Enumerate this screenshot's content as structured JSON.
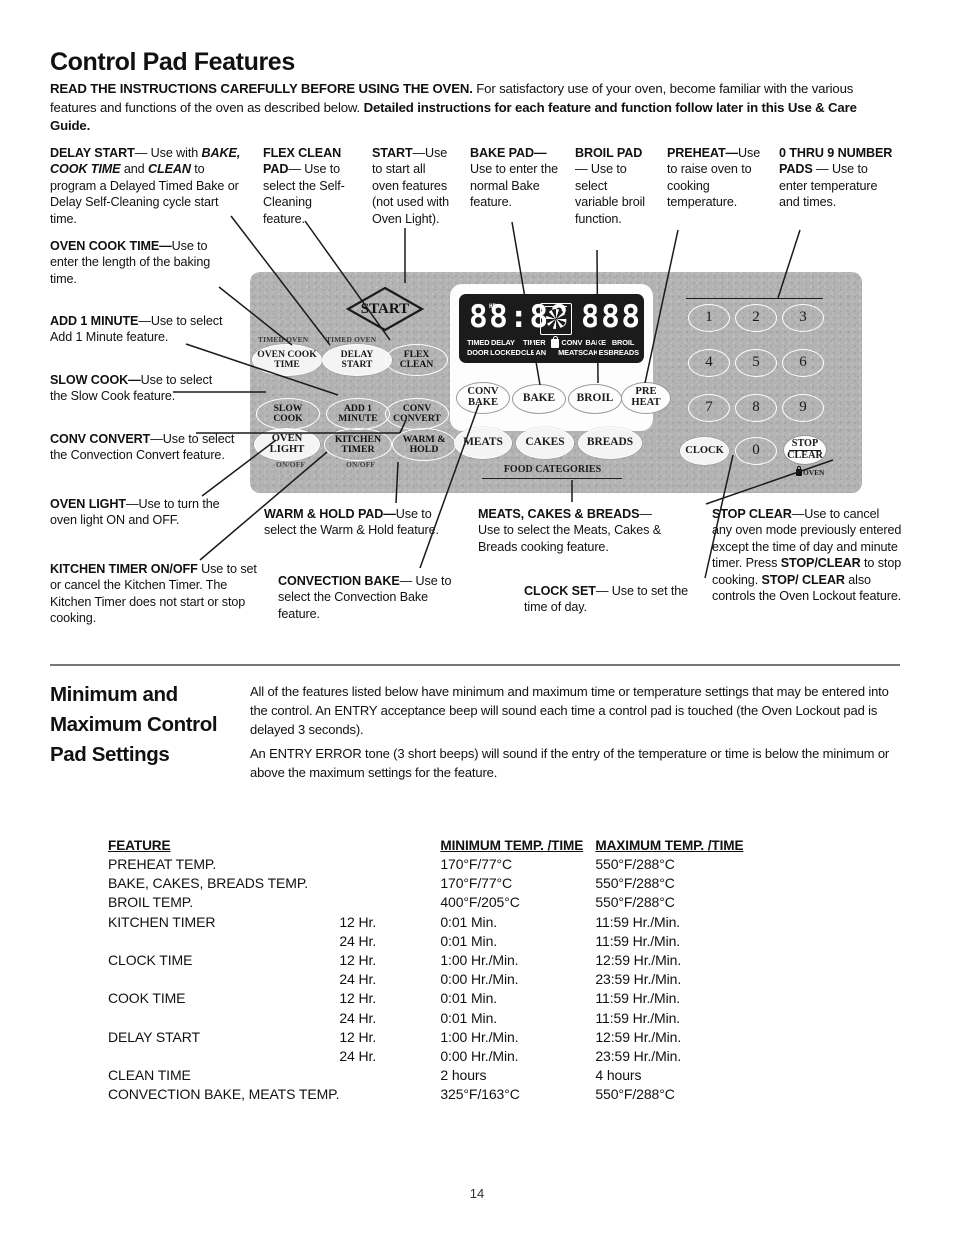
{
  "page": {
    "title": "Control Pad Features",
    "number": "14",
    "intro_bold_1": "READ THE INSTRUCTIONS CAREFULLY BEFORE USING THE OVEN.",
    "intro_plain_1": " For satisfactory use of your oven, become familiar with the various features and functions of the oven as described below. ",
    "intro_bold_2": "Detailed instructions for each feature and function follow later in this Use & Care Guide."
  },
  "callouts": {
    "delay_start": {
      "term": "DELAY START",
      "text_1": "— Use with ",
      "em_1": "BAKE, COOK TIME",
      "text_2": " and ",
      "em_2": "CLEAN",
      "text_3": " to program a Delayed Timed Bake or Delay Self-Cleaning cycle start time."
    },
    "oven_cook_time": {
      "term": "OVEN COOK TIME—",
      "text": "Use to enter the length of the baking time."
    },
    "add_1_minute": {
      "term": "ADD 1 MINUTE",
      "text": "—Use to select Add 1 Minute feature."
    },
    "slow_cook": {
      "term": "SLOW COOK—",
      "text": "Use to select the Slow Cook feature."
    },
    "conv_convert": {
      "term": "CONV CONVERT",
      "text": "—Use to select the Convection Convert feature."
    },
    "oven_light": {
      "term": "OVEN LIGHT",
      "text": "—Use to turn the oven light ON and OFF."
    },
    "kitchen_timer": {
      "term": "KITCHEN TIMER ON/OFF",
      "text": " Use to set or cancel the Kitchen Timer. The Kitchen Timer does not start or stop cooking."
    },
    "flex_clean": {
      "term": "FLEX CLEAN PAD",
      "text": "— Use to select the Self-Cleaning feature."
    },
    "start": {
      "term": "START",
      "text": "—Use to start all oven features (not used with Oven Light)."
    },
    "bake_pad": {
      "term": "BAKE PAD—",
      "text": "Use to enter the normal Bake feature."
    },
    "broil_pad": {
      "term": "BROIL PAD",
      "text": "— Use to select variable broil function."
    },
    "preheat": {
      "term": "PREHEAT—",
      "text": "Use to raise oven to cooking temperature."
    },
    "number_pads": {
      "term": "0 THRU 9 NUMBER PADS",
      "text": " — Use to enter temperature and times."
    },
    "warm_hold": {
      "term": "WARM & HOLD PAD—",
      "text": "Use to select the Warm & Hold feature."
    },
    "convection_bake": {
      "term": "CONVECTION BAKE",
      "text": "— Use to select the Convection Bake feature."
    },
    "meats_cakes_breads": {
      "term": "MEATS, CAKES & BREADS",
      "text": "— Use to select the Meats, Cakes & Breads cooking feature."
    },
    "clock_set": {
      "term": "CLOCK SET",
      "text": "— Use to set the time of day."
    },
    "stop_clear": {
      "term": "STOP CLEAR",
      "text_1": "—Use to cancel any oven mode previously entered except the time of day and minute timer. Press ",
      "bold_1": "STOP/CLEAR",
      "text_2": " to stop cooking. ",
      "bold_2": "STOP/ CLEAR",
      "text_3": " also controls the Oven Lockout feature."
    }
  },
  "control_panel": {
    "display": {
      "left_digits": "88:88",
      "hr_marker": "HR",
      "right_digits": "888",
      "indicators_row1": [
        "TIMED",
        "DELAY",
        "TIMER",
        "lock-icon",
        "CONV",
        "BAKE",
        "BROIL"
      ],
      "indicators_row2": [
        "DOOR",
        "LOCKED",
        "CLEAN",
        "",
        "MEATS",
        "CAKES",
        "BREADS"
      ]
    },
    "start_pad": "START",
    "mini_labels": {
      "timed_oven_left": "TIMED OVEN",
      "timed_oven_right": "TIMED OVEN",
      "oven_light_onoff": "ON/OFF",
      "kitchen_timer_onoff": "ON/OFF"
    },
    "pads_left": [
      {
        "line1": "OVEN COOK",
        "line2": "TIME"
      },
      {
        "line1": "DELAY",
        "line2": "START"
      },
      {
        "line1": "FLEX",
        "line2": "CLEAN"
      },
      {
        "line1": "SLOW",
        "line2": "COOK"
      },
      {
        "line1": "ADD 1",
        "line2": "MINUTE"
      },
      {
        "line1": "CONV",
        "line2": "CONVERT"
      },
      {
        "line1": "OVEN",
        "line2": "LIGHT"
      },
      {
        "line1": "KITCHEN",
        "line2": "TIMER"
      },
      {
        "line1": "WARM &",
        "line2": "HOLD"
      }
    ],
    "pads_function": [
      {
        "line1": "CONV",
        "line2": "BAKE"
      },
      {
        "line1": "BAKE",
        "line2": ""
      },
      {
        "line1": "BROIL",
        "line2": ""
      },
      {
        "line1": "PRE",
        "line2": "HEAT"
      }
    ],
    "pads_food": [
      "MEATS",
      "CAKES",
      "BREADS"
    ],
    "food_categories_label": "FOOD CATEGORIES",
    "number_pads": [
      "1",
      "2",
      "3",
      "4",
      "5",
      "6",
      "7",
      "8",
      "9",
      "0"
    ],
    "clock_pad": "CLOCK",
    "stop_clear_pad": {
      "line1": "STOP",
      "line2": "CLEAR"
    },
    "oven_lockout_label": "OVEN"
  },
  "minmax": {
    "heading": "Minimum and Maximum Control Pad Settings",
    "para1": "All of the features listed below have minimum and maximum time or temperature settings that may be entered into the control. An ENTRY acceptance beep will sound each time a control pad is touched (the Oven Lockout  pad is delayed 3 seconds).",
    "para2": "An ENTRY ERROR tone (3 short beeps) will sound if the entry of the temperature or time is below the minimum or above the maximum settings for the feature.",
    "headers": {
      "feature": "FEATURE",
      "hr": "",
      "minimum": "MINIMUM TEMP. /TIME",
      "maximum": "MAXIMUM TEMP. /TIME"
    },
    "rows": [
      {
        "feature": "PREHEAT TEMP.",
        "hr": "",
        "min": "170°F/77°C",
        "max": "550°F/288°C"
      },
      {
        "feature": "BAKE, CAKES, BREADS TEMP.",
        "hr": "",
        "min": "170°F/77°C",
        "max": "550°F/288°C"
      },
      {
        "feature": "BROIL TEMP.",
        "hr": "",
        "min": "400°F/205°C",
        "max": "550°F/288°C"
      },
      {
        "feature": "KITCHEN TIMER",
        "hr": "12 Hr.",
        "min": "0:01 Min.",
        "max": "11:59 Hr./Min."
      },
      {
        "feature": "",
        "hr": "24 Hr.",
        "min": "0:01 Min.",
        "max": "11:59 Hr./Min."
      },
      {
        "feature": "CLOCK TIME",
        "hr": "12 Hr.",
        "min": "1:00 Hr./Min.",
        "max": "12:59 Hr./Min."
      },
      {
        "feature": "",
        "hr": "24 Hr.",
        "min": "0:00 Hr./Min.",
        "max": "23:59 Hr./Min."
      },
      {
        "feature": "COOK TIME",
        "hr": "12 Hr.",
        "min": "0:01 Min.",
        "max": "11:59 Hr./Min."
      },
      {
        "feature": "",
        "hr": "24 Hr.",
        "min": "0:01 Min.",
        "max": "11:59 Hr./Min."
      },
      {
        "feature": "DELAY START",
        "hr": "12 Hr.",
        "min": "1:00 Hr./Min.",
        "max": "12:59 Hr./Min."
      },
      {
        "feature": "",
        "hr": "24 Hr.",
        "min": "0:00 Hr./Min.",
        "max": "23:59 Hr./Min."
      },
      {
        "feature": "CLEAN TIME",
        "hr": "",
        "min": "2 hours",
        "max": "4 hours"
      },
      {
        "feature": "CONVECTION BAKE, MEATS TEMP.",
        "hr": "",
        "min": "325°F/163°C",
        "max": "550°F/288°C"
      }
    ]
  }
}
